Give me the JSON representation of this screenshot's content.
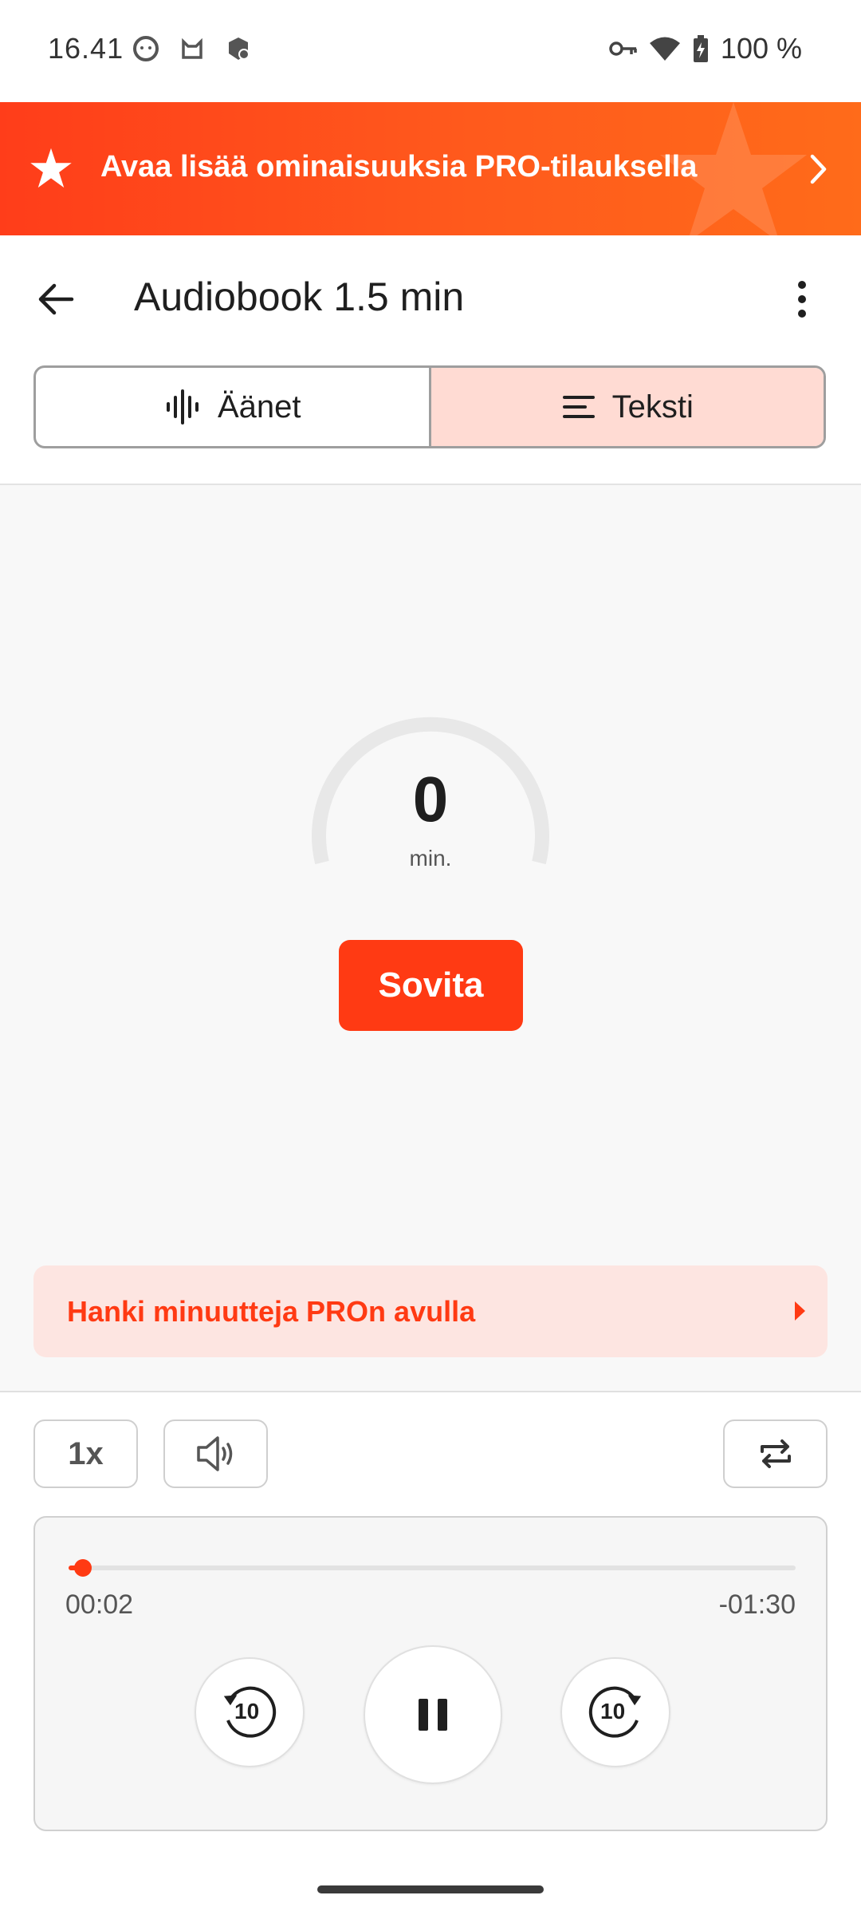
{
  "status_bar": {
    "time": "16.41",
    "battery": "100 %",
    "icons": [
      "cat-face-icon",
      "mi-icon",
      "app-badge-icon",
      "vpn-key-icon",
      "wifi-icon",
      "battery-charging-icon"
    ]
  },
  "promo": {
    "text": "Avaa lisää ominaisuuksia PRO-tilauksella",
    "colors": {
      "start": "#ff3d1a",
      "end": "#ff6b1a"
    }
  },
  "header": {
    "title": "Audiobook 1.5 min"
  },
  "tabs": [
    {
      "label": "Äänet",
      "icon": "waveform-icon",
      "active": false
    },
    {
      "label": "Teksti",
      "icon": "text-lines-icon",
      "active": true
    }
  ],
  "gauge": {
    "value": "0",
    "unit": "min.",
    "fraction": 0
  },
  "fit_button": {
    "label": "Sovita"
  },
  "pro_row": {
    "label": "Hanki minuutteja PROn avulla"
  },
  "controls": {
    "speed": "1x",
    "volume_icon": "volume-icon",
    "repeat_icon": "repeat-icon"
  },
  "player": {
    "elapsed": "00:02",
    "remaining": "-01:30",
    "progress_fraction": 0.02,
    "skip_back": "10",
    "skip_forward": "10",
    "state": "playing"
  },
  "accent_color": "#ff3a13"
}
